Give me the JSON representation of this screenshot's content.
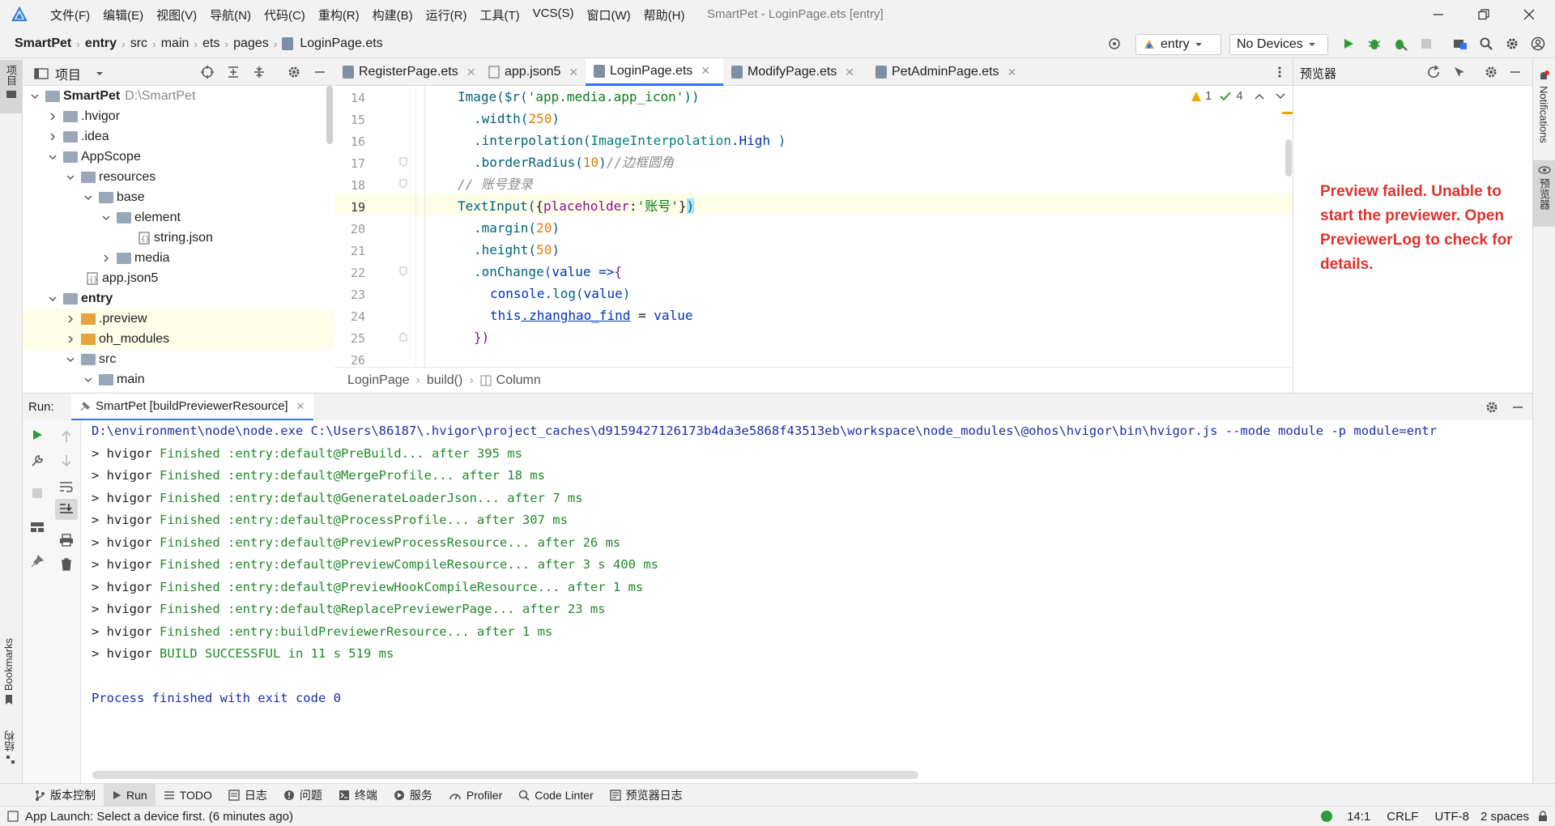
{
  "window": {
    "title": "SmartPet - LoginPage.ets [entry]",
    "menu": [
      "文件(F)",
      "编辑(E)",
      "视图(V)",
      "导航(N)",
      "代码(C)",
      "重构(R)",
      "构建(B)",
      "运行(R)",
      "工具(T)",
      "VCS(S)",
      "窗口(W)",
      "帮助(H)"
    ]
  },
  "breadcrumb": [
    "SmartPet",
    "entry",
    "src",
    "main",
    "ets",
    "pages",
    "LoginPage.ets"
  ],
  "toolbar": {
    "module_select": "entry",
    "device_select": "No Devices"
  },
  "left_strip": {
    "project": "项目",
    "bookmarks": "Bookmarks",
    "structure": "结构"
  },
  "right_strip": {
    "notifications": "Notifications",
    "previewer": "预览器"
  },
  "project": {
    "title": "项目",
    "tree": [
      {
        "label": "SmartPet",
        "extra": "D:\\SmartPet",
        "bold": true
      },
      {
        "label": ".hvigor"
      },
      {
        "label": ".idea"
      },
      {
        "label": "AppScope"
      },
      {
        "label": "resources"
      },
      {
        "label": "base"
      },
      {
        "label": "element"
      },
      {
        "label": "string.json"
      },
      {
        "label": "media"
      },
      {
        "label": "app.json5"
      },
      {
        "label": "entry",
        "bold": true
      },
      {
        "label": ".preview"
      },
      {
        "label": "oh_modules"
      },
      {
        "label": "src"
      },
      {
        "label": "main"
      }
    ]
  },
  "tabs": [
    {
      "label": "RegisterPage.ets"
    },
    {
      "label": "app.json5"
    },
    {
      "label": "LoginPage.ets",
      "active": true
    },
    {
      "label": "ModifyPage.ets"
    },
    {
      "label": "PetAdminPage.ets"
    }
  ],
  "editor": {
    "line_numbers": [
      "14",
      "15",
      "16",
      "17",
      "18",
      "19",
      "20",
      "21",
      "22",
      "23",
      "24",
      "25",
      "26"
    ],
    "warnings": "1",
    "checks": "4",
    "code_tokens": {
      "l14a": "Image($r(",
      "l14b": "'app.media.app_icon'",
      "l14c": "))",
      "l15a": ".width(",
      "l15b": "250",
      "l15c": ")",
      "l16a": ".interpolation(",
      "l16b": "ImageInterpolation",
      "l16c": ".High",
      "l16d": " )",
      "l17a": ".borderRadius(",
      "l17b": "10",
      "l17c": ")",
      "l17d": "//边框圆角",
      "l18": "// 账号登录",
      "l19a": "TextInput(",
      "l19b": "{",
      "l19c": "placeholder",
      "l19d": ":",
      "l19e": "'账号'",
      "l19f": "}",
      "l19g": ")",
      "l20a": ".margin(",
      "l20b": "20",
      "l20c": ")",
      "l21a": ".height(",
      "l21b": "50",
      "l21c": ")",
      "l22a": ".onChange(",
      "l22b": "value",
      "l22c": " =>",
      "l22d": "{",
      "l23a": "console",
      "l23b": ".log(",
      "l23c": "value",
      "l23d": ")",
      "l24a": "this",
      "l24b": ".zhanghao_find",
      "l24c": " = ",
      "l24d": "value",
      "l25": "})"
    },
    "breadcrumbs": [
      "LoginPage",
      "build()",
      "Column"
    ]
  },
  "previewer": {
    "title": "预览器",
    "error": "Preview failed. Unable to start the previewer. Open PreviewerLog to check for details."
  },
  "run": {
    "label": "Run:",
    "config": "SmartPet [buildPreviewerResource]",
    "lines": [
      {
        "text": "D:\\environment\\node\\node.exe C:\\Users\\86187\\.hvigor\\project_caches\\d9159427126173b4da3e5868f43513eb\\workspace\\node_modules\\@ohos\\hvigor\\bin\\hvigor.js --mode module -p module=entr",
        "style": "blue"
      },
      {
        "prefix": "> hvigor ",
        "text": "Finished :entry:default@PreBuild... after 395 ms",
        "style": "green"
      },
      {
        "prefix": "> hvigor ",
        "text": "Finished :entry:default@MergeProfile... after 18 ms",
        "style": "green"
      },
      {
        "prefix": "> hvigor ",
        "text": "Finished :entry:default@GenerateLoaderJson... after 7 ms",
        "style": "green"
      },
      {
        "prefix": "> hvigor ",
        "text": "Finished :entry:default@ProcessProfile... after 307 ms",
        "style": "green"
      },
      {
        "prefix": "> hvigor ",
        "text": "Finished :entry:default@PreviewProcessResource... after 26 ms",
        "style": "green"
      },
      {
        "prefix": "> hvigor ",
        "text": "Finished :entry:default@PreviewCompileResource... after 3 s 400 ms",
        "style": "green"
      },
      {
        "prefix": "> hvigor ",
        "text": "Finished :entry:default@PreviewHookCompileResource... after 1 ms",
        "style": "green"
      },
      {
        "prefix": "> hvigor ",
        "text": "Finished :entry:default@ReplacePreviewerPage... after 23 ms",
        "style": "green"
      },
      {
        "prefix": "> hvigor ",
        "text": "Finished :entry:buildPreviewerResource... after 1 ms",
        "style": "green"
      },
      {
        "prefix": "> hvigor ",
        "text": "BUILD SUCCESSFUL in 11 s 519 ms",
        "style": "green"
      },
      {
        "text": "",
        "style": "blue"
      },
      {
        "text": "Process finished with exit code 0",
        "style": "blue"
      }
    ]
  },
  "tool_windows": [
    "版本控制",
    "Run",
    "TODO",
    "日志",
    "问题",
    "终端",
    "服务",
    "Profiler",
    "Code Linter",
    "预览器日志"
  ],
  "status": {
    "message": "App Launch: Select a device first. (6 minutes ago)",
    "position": "14:1",
    "line_sep": "CRLF",
    "encoding": "UTF-8",
    "indent": "2 spaces"
  },
  "colors": {
    "accent": "#3574f0",
    "error_text": "#e0322c",
    "run_green": "#2e9b3a",
    "folder": "#9aa7b8",
    "folder_orange": "#e8a33c"
  }
}
